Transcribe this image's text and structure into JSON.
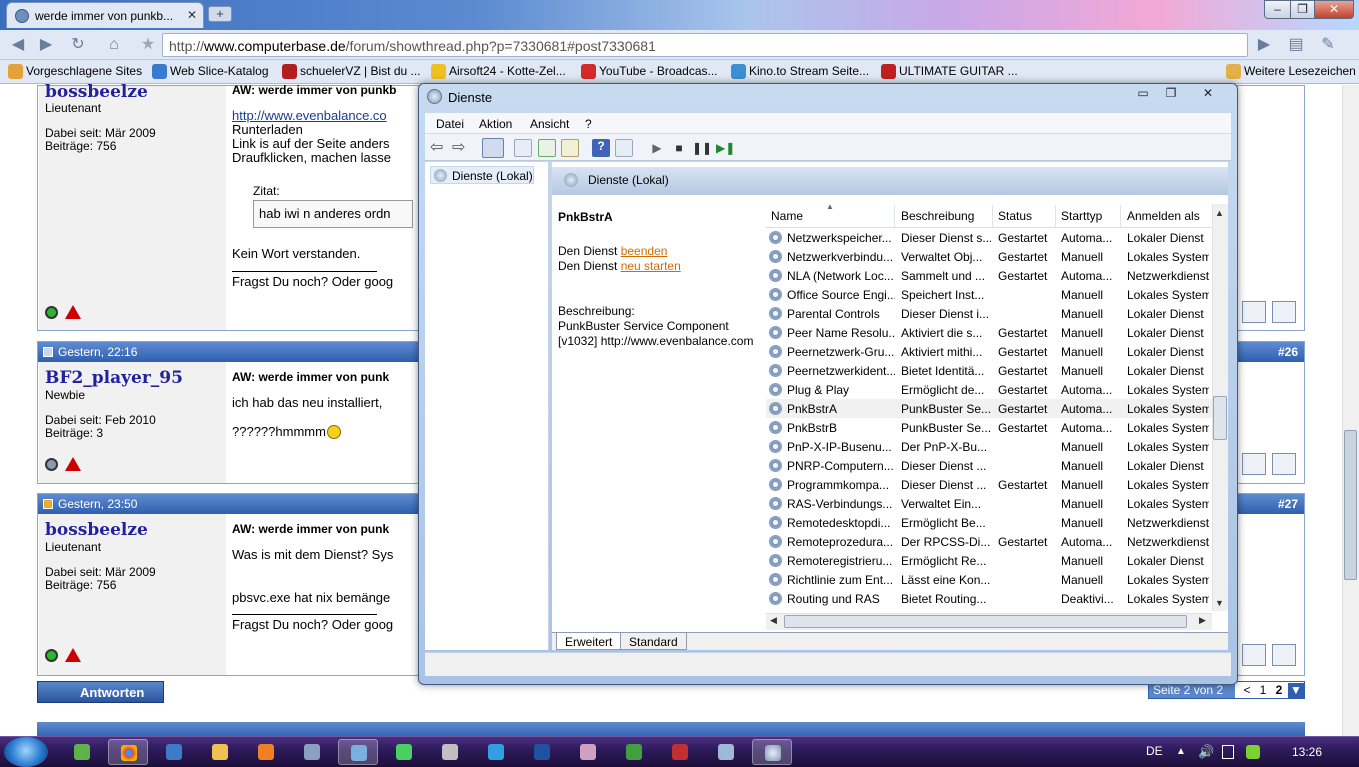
{
  "browser": {
    "tab_title": "werde immer von punkb...",
    "new_tab_label": "+",
    "address": "http://www.computerbase.de/forum/showthread.php?p=7330681#post7330681",
    "address_host": "www.computerbase.de",
    "address_prefix": "http://",
    "address_path": "/forum/showthread.php?p=7330681#post7330681",
    "bookmarks": [
      {
        "label": "Vorgeschlagene Sites",
        "icon": "star-folder-icon"
      },
      {
        "label": "Web Slice-Katalog",
        "icon": "ie-icon"
      },
      {
        "label": "schuelerVZ | Bist du ...",
        "icon": "vz-icon"
      },
      {
        "label": "Airsoft24 - Kotte-Zel...",
        "icon": "airsoft-icon"
      },
      {
        "label": "YouTube - Broadcas...",
        "icon": "youtube-icon"
      },
      {
        "label": "Kino.to Stream Seite...",
        "icon": "kino-icon"
      },
      {
        "label": "ULTIMATE GUITAR ...",
        "icon": "guitar-icon"
      }
    ],
    "other_bookmarks": "Weitere Lesezeichen"
  },
  "forum": {
    "posts": [
      {
        "username": "bossbeelze",
        "rank": "Lieutenant",
        "joined": "Dabei seit: Mär 2009",
        "posts": "Beiträge: 756",
        "title": "AW: werde immer von punkb",
        "link": "http://www.evenbalance.co",
        "lines": [
          "Runterladen",
          "Link is auf der Seite anders",
          "Draufklicken, machen lasse"
        ],
        "quote_label": "Zitat:",
        "quote_text": "hab iwi n anderes ordn",
        "text": "Kein Wort verstanden.",
        "signature": "Fragst Du noch? Oder goog"
      },
      {
        "date": "Gestern, 22:16",
        "number": "#26",
        "username": "BF2_player_95",
        "rank": "Newbie",
        "joined": "Dabei seit: Feb 2010",
        "posts": "Beiträge: 3",
        "title": "AW: werde immer von punk",
        "text1": "ich hab das neu installiert,",
        "text2": "??????hmmmm"
      },
      {
        "date": "Gestern, 23:50",
        "number": "#27",
        "username": "bossbeelze",
        "rank": "Lieutenant",
        "joined": "Dabei seit: Mär 2009",
        "posts": "Beiträge: 756",
        "title": "AW: werde immer von punk",
        "text1": "Was is mit dem Dienst? Sys",
        "text2": "pbsvc.exe hat nix bemänge",
        "signature": "Fragst Du noch? Oder goog"
      }
    ],
    "reply_button": "Antworten",
    "page_label": "Seite 2 von 2",
    "page_prev": "<",
    "page_1": "1",
    "page_2": "2"
  },
  "services": {
    "window_title": "Dienste",
    "menu": [
      "Datei",
      "Aktion",
      "Ansicht",
      "?"
    ],
    "tree_item": "Dienste (Lokal)",
    "pane_header": "Dienste (Lokal)",
    "selected_name": "PnkBstrA",
    "stop_prefix": "Den Dienst ",
    "stop_link": "beenden",
    "restart_prefix": "Den Dienst ",
    "restart_link": "neu starten",
    "description_label": "Beschreibung:",
    "description_line1": "PunkBuster Service Component",
    "description_line2": "[v1032] http://www.evenbalance.com",
    "columns": [
      "Name",
      "Beschreibung",
      "Status",
      "Starttyp",
      "Anmelden als"
    ],
    "rows": [
      [
        "Netzwerkspeicher...",
        "Dieser Dienst s...",
        "Gestartet",
        "Automa...",
        "Lokaler Dienst"
      ],
      [
        "Netzwerkverbindu...",
        "Verwaltet Obj...",
        "Gestartet",
        "Manuell",
        "Lokales System"
      ],
      [
        "NLA (Network Loc...",
        "Sammelt und ...",
        "Gestartet",
        "Automa...",
        "Netzwerkdienst"
      ],
      [
        "Office Source Engi...",
        "Speichert Inst...",
        "",
        "Manuell",
        "Lokales System"
      ],
      [
        "Parental Controls",
        "Dieser Dienst i...",
        "",
        "Manuell",
        "Lokaler Dienst"
      ],
      [
        "Peer Name Resolu...",
        "Aktiviert die s...",
        "Gestartet",
        "Manuell",
        "Lokaler Dienst"
      ],
      [
        "Peernetzwerk-Gru...",
        "Aktiviert mithi...",
        "Gestartet",
        "Manuell",
        "Lokaler Dienst"
      ],
      [
        "Peernetzwerkident...",
        "Bietet Identitä...",
        "Gestartet",
        "Manuell",
        "Lokaler Dienst"
      ],
      [
        "Plug & Play",
        "Ermöglicht de...",
        "Gestartet",
        "Automa...",
        "Lokales System"
      ],
      [
        "PnkBstrA",
        "PunkBuster Se...",
        "Gestartet",
        "Automa...",
        "Lokales System"
      ],
      [
        "PnkBstrB",
        "PunkBuster Se...",
        "Gestartet",
        "Automa...",
        "Lokales System"
      ],
      [
        "PnP-X-IP-Busenu...",
        "Der PnP-X-Bu...",
        "",
        "Manuell",
        "Lokales System"
      ],
      [
        "PNRP-Computern...",
        "Dieser Dienst ...",
        "",
        "Manuell",
        "Lokaler Dienst"
      ],
      [
        "Programmkompa...",
        "Dieser Dienst ...",
        "Gestartet",
        "Manuell",
        "Lokales System"
      ],
      [
        "RAS-Verbindungs...",
        "Verwaltet Ein...",
        "",
        "Manuell",
        "Lokales System"
      ],
      [
        "Remotedesktopdi...",
        "Ermöglicht Be...",
        "",
        "Manuell",
        "Netzwerkdienst"
      ],
      [
        "Remoteprozedura...",
        "Der RPCSS-Di...",
        "Gestartet",
        "Automa...",
        "Netzwerkdienst"
      ],
      [
        "Remoteregistrieru...",
        "Ermöglicht Re...",
        "",
        "Manuell",
        "Lokaler Dienst"
      ],
      [
        "Richtlinie zum Ent...",
        "Lässt eine Kon...",
        "",
        "Manuell",
        "Lokales System"
      ],
      [
        "Routing und RAS",
        "Bietet Routing...",
        "",
        "Deaktivi...",
        "Lokales System"
      ]
    ],
    "selected_row": "PnkBstrA",
    "tab_extended": "Erweitert",
    "tab_standard": "Standard"
  },
  "taskbar": {
    "language": "DE",
    "clock": "13:26"
  }
}
